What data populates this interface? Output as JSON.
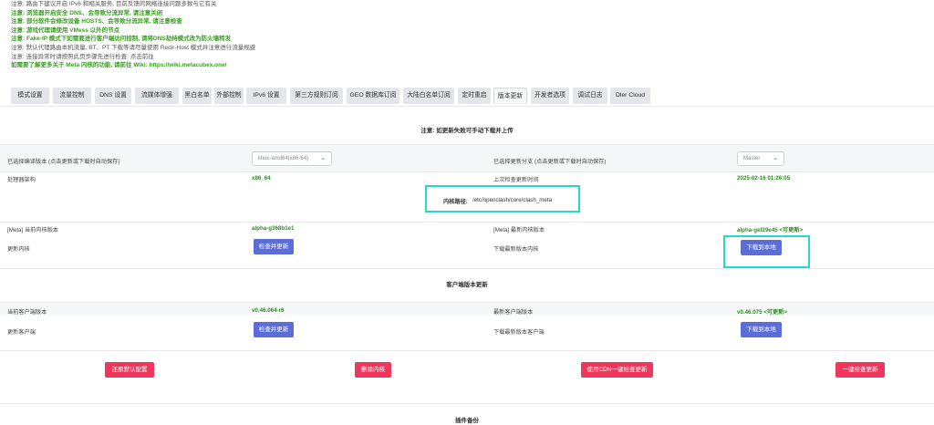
{
  "notices": [
    {
      "text": "注意: 路由下建议开启 IPv6 和相关服务, 目前反馈的网络连接问题多数与它有关",
      "style": "gray"
    },
    {
      "text": "注意: 浏览器开启安全 DNS、会导致分流异常, 请注意关闭",
      "style": "green"
    },
    {
      "text": "注意: 部分软件会修改设备 HOSTS、会导致分流异常, 请注意检查",
      "style": "green"
    },
    {
      "text": "注意: 游戏代理请使用 VMess 以外的节点",
      "style": "green"
    },
    {
      "text": "注意: Fake-IP 模式下如需要进行客户端访问控制, 请将DNS劫持模式改为防火墙转发",
      "style": "green"
    },
    {
      "text": "注意: 默认代理路由本机流量, BT、PT 下载等请尽量使用 Redir-Host 模式并注意进行流量规避",
      "style": "gray"
    },
    {
      "text": "注意: 连接异常时请按照此页步骤先进行检查: 点击前往",
      "style": "gray"
    },
    {
      "text": "如需要了解更多关于 Meta 内核的功能, 请前往 Wiki: https://wiki.metacubex.one/",
      "style": "green"
    }
  ],
  "tabs": [
    {
      "label": "模式设置"
    },
    {
      "label": "流量控制"
    },
    {
      "label": "DNS 设置"
    },
    {
      "label": "流媒体增强"
    },
    {
      "label": "黑白名单"
    },
    {
      "label": "外部控制"
    },
    {
      "label": "IPv6 设置"
    },
    {
      "label": "第三方规则订阅"
    },
    {
      "label": "GEO 数据库订阅"
    },
    {
      "label": "大陆白名单订阅"
    },
    {
      "label": "定时重启"
    },
    {
      "label": "版本更新"
    },
    {
      "label": "开发者选项"
    },
    {
      "label": "调试日志"
    },
    {
      "label": "Dler Cloud"
    }
  ],
  "core_section": {
    "title": "注意: 如更新失败可手动下载并上传",
    "compile_version_label": "已选择编译版本 (点击更新或下载时自动保存)",
    "compile_version_value": "linux-amd64(x86-64)",
    "branch_label": "已选择更新分支 (点击更新或下载时自动保存)",
    "branch_value": "Master",
    "arch_label": "处理器架构",
    "arch_value": "x86_64",
    "last_check_label": "上次检查更新时间",
    "last_check_value": "2025-02-16 01:26:05",
    "core_path_label": "内核路径:",
    "core_path_value": "/etc/openclash/core/clash_meta",
    "current_core_label": "[Meta] 当前内核版本",
    "current_core_value": "alpha-g368b1e1",
    "latest_core_label": "[Meta] 最新内核版本",
    "latest_core_value": "alpha-gef29e45 <可更新>",
    "update_core_label": "更新内核",
    "update_core_button": "检查并更新",
    "download_core_label": "下载最新版本内核",
    "download_core_button": "下载到本地"
  },
  "client_section": {
    "title": "客户端版本更新",
    "current_client_label": "当前客户端版本",
    "current_client_value": "v0.46.064-r6",
    "latest_client_label": "最新客户端版本",
    "latest_client_value": "v0.46.075 <可更新>",
    "update_client_label": "更新客户端",
    "update_client_button": "检查并更新",
    "download_client_label": "下载最新版本客户端",
    "download_client_button": "下载到本地"
  },
  "actions": {
    "restore_default": "还原默认配置",
    "delete_core": "删除内核",
    "cdn_update": "使用CDN一键检查更新",
    "one_click_update": "一键检查更新"
  },
  "plugin_backup_title": "插件备份"
}
